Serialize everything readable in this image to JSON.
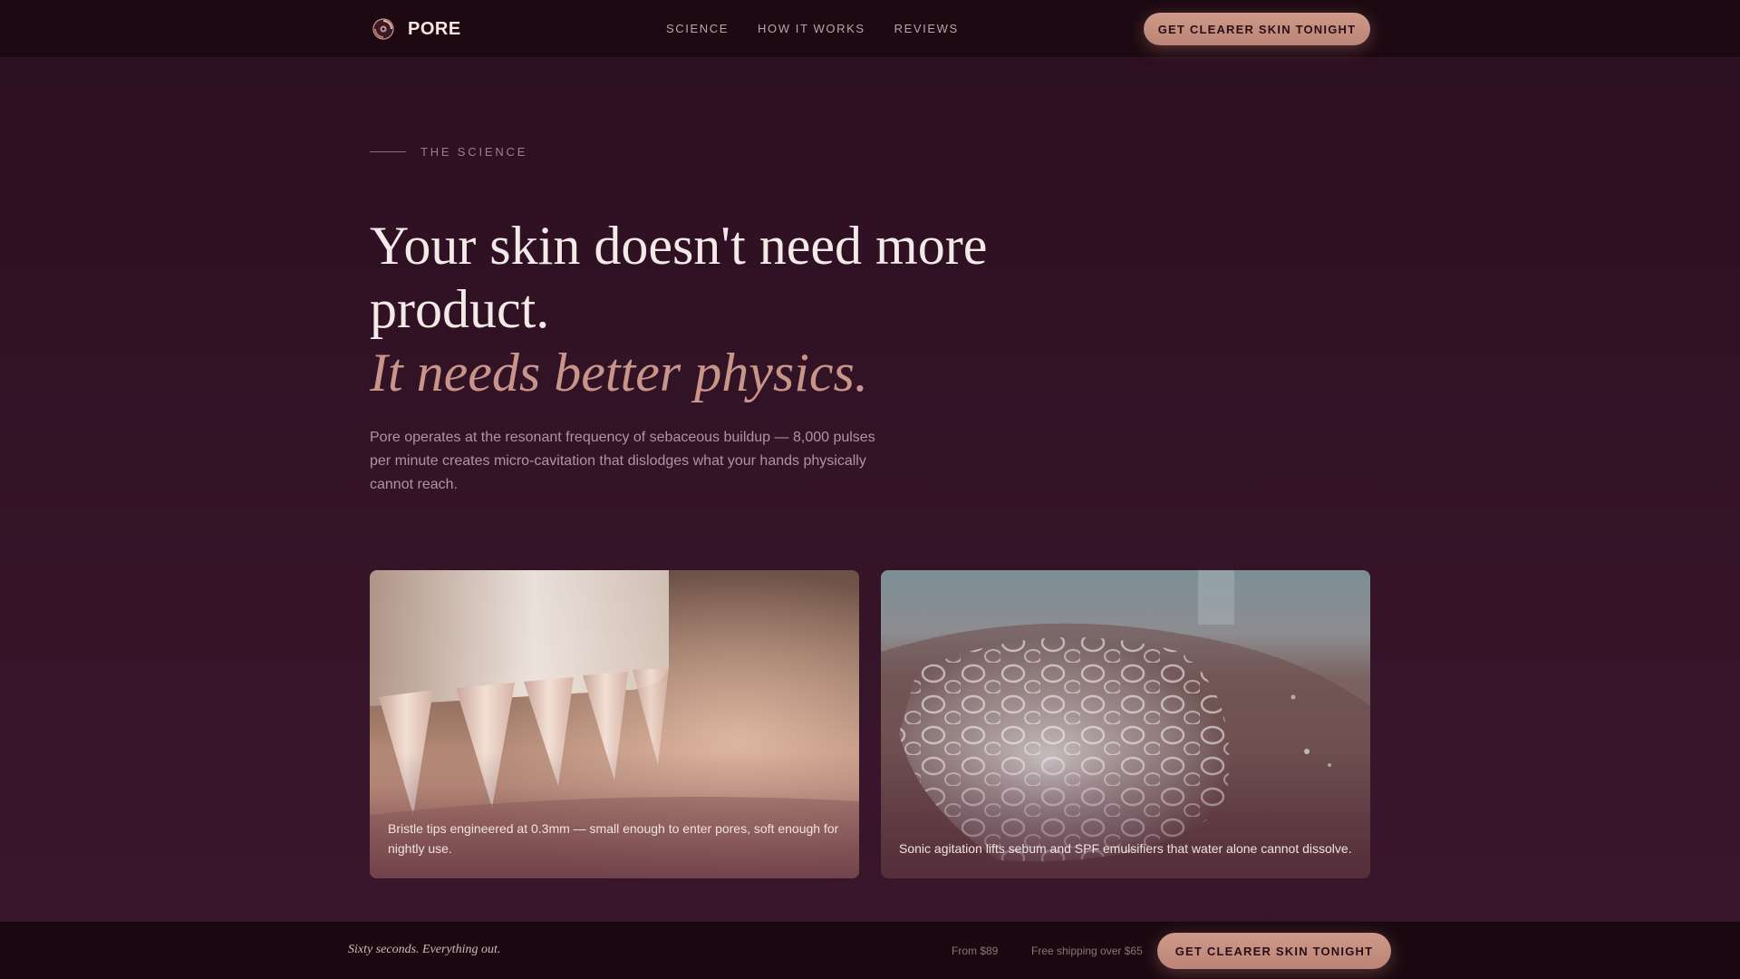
{
  "header": {
    "brand_name": "PORE",
    "nav": [
      {
        "label": "SCIENCE"
      },
      {
        "label": "HOW IT WORKS"
      },
      {
        "label": "REVIEWS"
      }
    ],
    "cta_label": "GET CLEARER SKIN TONIGHT"
  },
  "hero": {
    "eyebrow": "THE SCIENCE",
    "headline": "Your skin doesn't need more product.",
    "headline_accent": "It needs better physics.",
    "lede": "Pore operates at the resonant frequency of sebaceous buildup — 8,000 pulses per minute creates micro-cavitation that dislodges what your hands physically cannot reach."
  },
  "cards": [
    {
      "image_icon": "bristle-closeup-image",
      "caption": "Bristle tips engineered at 0.3mm — small enough to enter pores, soft enough for nightly use."
    },
    {
      "image_icon": "foam-on-skin-image",
      "caption": "Sonic agitation lifts sebum and SPF emulsifiers that water alone cannot dissolve."
    }
  ],
  "sticky_bar": {
    "tagline": "Sixty seconds. Everything out.",
    "price": "From $89",
    "shipping": "Free shipping over $65",
    "cta_label": "GET CLEARER SKIN TONIGHT"
  },
  "colors": {
    "background": "#2c0f20",
    "nav_background": "#1c0911",
    "accent": "#c9958a",
    "cta": "#cf9a8a",
    "text": "#f3e9e6",
    "muted": "#ad969d"
  }
}
